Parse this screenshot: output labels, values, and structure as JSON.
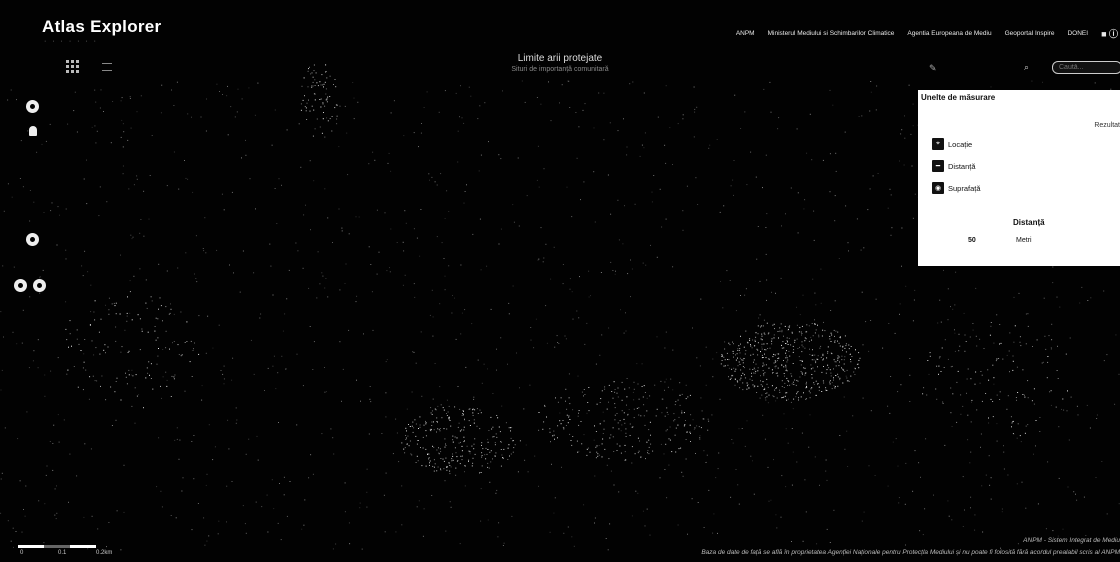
{
  "header": {
    "app_title": "Atlas Explorer",
    "nav": [
      "ANPM",
      "Ministerul Mediului si Schimbarilor Climatice",
      "Agentia Europeana de Mediu",
      "Geoportal Inspire",
      "DONEI"
    ],
    "nav_icons": "■ ⓘ"
  },
  "map": {
    "title": "Limite arii protejate",
    "subtitle": "Situri de importanță comunitară"
  },
  "search": {
    "placeholder": "Caută..."
  },
  "measure_panel": {
    "title": "Unelte de măsurare",
    "corner_label": "Rezultat",
    "items": [
      {
        "label": "Locație",
        "icon": "location-icon"
      },
      {
        "label": "Distanță",
        "icon": "distance-icon"
      },
      {
        "label": "Suprafață",
        "icon": "area-icon"
      }
    ],
    "result_label": "Distanță",
    "result_value": "50",
    "result_unit": "Metri"
  },
  "scale": {
    "labels": [
      "0",
      "0.1",
      "0.2km"
    ]
  },
  "attribution": {
    "line1": "ANPM - Sistem Integrat de Mediu",
    "line2": "Baza de date de față se află în proprietatea Agenției Naționale pentru Protecția Mediului și nu poate fi folosită fără acordul prealabil scris al ANPM"
  },
  "colors": {
    "background": "#000000",
    "panel": "#ffffff",
    "text": "#ffffff"
  }
}
